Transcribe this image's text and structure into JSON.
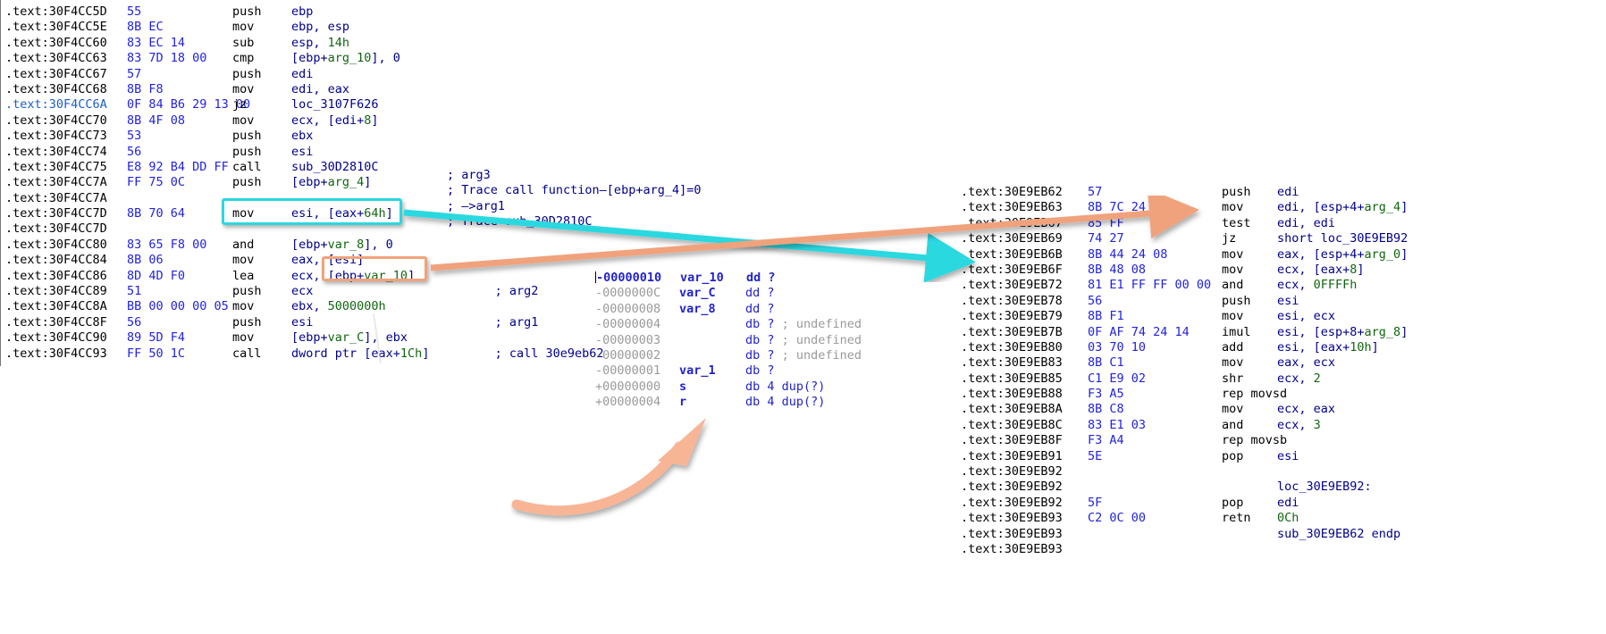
{
  "colors": {
    "highlight_cyan": "#29d8e0",
    "highlight_orange": "#f0a27b",
    "address_text": "#000000",
    "opcode_bytes": "#2222dd",
    "operand": "#00008b",
    "immediate": "#116611",
    "stack_offset_gray": "#9a9a9a",
    "background": "#ffffff"
  },
  "left_listing": {
    "name": "left-disassembly-listing",
    "rows": [
      {
        "addr": ".text:30F4CC5D",
        "bytes": "55",
        "mnem": "push",
        "op": "ebp",
        "op_pre": "",
        "num": "",
        "op_post": "",
        "cmt": ""
      },
      {
        "addr": ".text:30F4CC5E",
        "bytes": "8B EC",
        "mnem": "mov",
        "op": "ebp, esp",
        "cmt": ""
      },
      {
        "addr": ".text:30F4CC60",
        "bytes": "83 EC 14",
        "mnem": "sub",
        "op_pre": "esp, ",
        "num": "14h",
        "op_post": "",
        "cmt": ""
      },
      {
        "addr": ".text:30F4CC63",
        "bytes": "83 7D 18 00",
        "mnem": "cmp",
        "op_pre": "[ebp+",
        "num": "arg_10",
        "op_post": "], 0",
        "cmt": ""
      },
      {
        "addr": ".text:30F4CC67",
        "bytes": "57",
        "mnem": "push",
        "op": "edi",
        "cmt": ""
      },
      {
        "addr": ".text:30F4CC68",
        "bytes": "8B F8",
        "mnem": "mov",
        "op": "edi, eax",
        "cmt": ""
      },
      {
        "addr": ".text:30F4CC6A",
        "bytes": "0F 84 B6 29 13 00",
        "mnem": "jz",
        "op": "loc_3107F626",
        "cmt": "",
        "addr_highlight": true
      },
      {
        "addr": ".text:30F4CC70",
        "bytes": "8B 4F 08",
        "mnem": "mov",
        "op_pre": "ecx, [edi+",
        "num": "8",
        "op_post": "]",
        "cmt": ""
      },
      {
        "addr": ".text:30F4CC73",
        "bytes": "53",
        "mnem": "push",
        "op": "ebx",
        "cmt": ""
      },
      {
        "addr": ".text:30F4CC74",
        "bytes": "56",
        "mnem": "push",
        "op": "esi",
        "cmt": ""
      },
      {
        "addr": ".text:30F4CC75",
        "bytes": "E8 92 B4 DD FF",
        "mnem": "call",
        "op": "sub_30D2810C",
        "cmt": ""
      },
      {
        "addr": ".text:30F4CC7A",
        "bytes": "FF 75 0C",
        "mnem": "push",
        "op_pre": "[ebp+",
        "num": "arg_4",
        "op_post": "]",
        "cmt": ""
      },
      {
        "addr": ".text:30F4CC7A",
        "bytes": "",
        "mnem": "",
        "op": "",
        "cmt": ""
      },
      {
        "addr": ".text:30F4CC7D",
        "bytes": "8B 70 64",
        "mnem": "mov",
        "op_pre": "esi, [eax+",
        "num": "64h",
        "op_post": "]",
        "cmt": ""
      },
      {
        "addr": ".text:30F4CC7D",
        "bytes": "",
        "mnem": "",
        "op": "",
        "cmt": ""
      },
      {
        "addr": ".text:30F4CC80",
        "bytes": "83 65 F8 00",
        "mnem": "and",
        "op_pre": "[ebp+",
        "num": "var_8",
        "op_post": "], 0",
        "cmt": ""
      },
      {
        "addr": ".text:30F4CC84",
        "bytes": "8B 06",
        "mnem": "mov",
        "op": "eax, [esi]",
        "cmt": ""
      },
      {
        "addr": ".text:30F4CC86",
        "bytes": "8D 4D F0",
        "mnem": "lea",
        "op_pre": "ecx, [ebp+",
        "num": "var_10",
        "op_post": "]",
        "cmt": ""
      },
      {
        "addr": ".text:30F4CC89",
        "bytes": "51",
        "mnem": "push",
        "op": "ecx",
        "cmt": "; arg2"
      },
      {
        "addr": ".text:30F4CC8A",
        "bytes": "BB 00 00 00 05",
        "mnem": "mov",
        "op_pre": "ebx, ",
        "num": "5000000h",
        "op_post": "",
        "cmt": ""
      },
      {
        "addr": ".text:30F4CC8F",
        "bytes": "56",
        "mnem": "push",
        "op": "esi",
        "cmt": "; arg1"
      },
      {
        "addr": ".text:30F4CC90",
        "bytes": "89 5D F4",
        "mnem": "mov",
        "op_pre": "[ebp+",
        "num": "var_C",
        "op_post": "], ebx",
        "cmt": ""
      },
      {
        "addr": ".text:30F4CC93",
        "bytes": "FF 50 1C",
        "mnem": "call",
        "op_pre": "dword ptr [eax+",
        "num": "1Ch",
        "op_post": "]",
        "cmt": "; call 30e9eb62"
      }
    ]
  },
  "comment_block": {
    "name": "trace-comment-block",
    "lines": [
      "; arg3",
      "; Trace call function—[ebp+arg_4]=0",
      "; —>arg1",
      "; Trace sub_30D2810C"
    ]
  },
  "stack_frame": {
    "name": "stack-frame-variables",
    "rows": [
      {
        "off": "-00000010",
        "nm": "var_10",
        "rest": "dd ?",
        "cmt": "",
        "selected": true
      },
      {
        "off": "-0000000C",
        "nm": "var_C",
        "rest": "dd ?",
        "cmt": "",
        "selected": false
      },
      {
        "off": "-00000008",
        "nm": "var_8",
        "rest": "dd ?",
        "cmt": "",
        "selected": false
      },
      {
        "off": "-00000004",
        "nm": "",
        "rest": "db ?",
        "cmt": "; undefined",
        "selected": false
      },
      {
        "off": "-00000003",
        "nm": "",
        "rest": "db ?",
        "cmt": "; undefined",
        "selected": false
      },
      {
        "off": "-00000002",
        "nm": "",
        "rest": "db ?",
        "cmt": "; undefined",
        "selected": false
      },
      {
        "off": "-00000001",
        "nm": "var_1",
        "rest": "db ?",
        "cmt": "",
        "selected": false
      },
      {
        "off": "+00000000",
        "nm": "s",
        "rest": "db 4 dup(?)",
        "cmt": "",
        "selected": false
      },
      {
        "off": "+00000004",
        "nm": "r",
        "rest": "db 4 dup(?)",
        "cmt": "",
        "selected": false
      }
    ]
  },
  "right_listing": {
    "name": "right-disassembly-listing",
    "rows": [
      {
        "addr": ".text:30E9EB62",
        "bytes": "57",
        "mnem": "push",
        "op_pre": "edi",
        "num": "",
        "op_post": ""
      },
      {
        "addr": ".text:30E9EB63",
        "bytes": "8B 7C 24 0C",
        "mnem": "mov",
        "op_pre": "edi, [esp+4+",
        "num": "arg_4",
        "op_post": "]"
      },
      {
        "addr": ".text:30E9EB67",
        "bytes": "85 FF",
        "mnem": "test",
        "op_pre": "edi, edi",
        "num": "",
        "op_post": ""
      },
      {
        "addr": ".text:30E9EB69",
        "bytes": "74 27",
        "mnem": "jz",
        "op_pre": "short loc_30E9EB92",
        "num": "",
        "op_post": ""
      },
      {
        "addr": ".text:30E9EB6B",
        "bytes": "8B 44 24 08",
        "mnem": "mov",
        "op_pre": "eax, [esp+4+",
        "num": "arg_0",
        "op_post": "]"
      },
      {
        "addr": ".text:30E9EB6F",
        "bytes": "8B 48 08",
        "mnem": "mov",
        "op_pre": "ecx, [eax+",
        "num": "8",
        "op_post": "]"
      },
      {
        "addr": ".text:30E9EB72",
        "bytes": "81 E1 FF FF 00 00",
        "mnem": "and",
        "op_pre": "ecx, ",
        "num": "0FFFFh",
        "op_post": ""
      },
      {
        "addr": ".text:30E9EB78",
        "bytes": "56",
        "mnem": "push",
        "op_pre": "esi",
        "num": "",
        "op_post": ""
      },
      {
        "addr": ".text:30E9EB79",
        "bytes": "8B F1",
        "mnem": "mov",
        "op_pre": "esi, ecx",
        "num": "",
        "op_post": ""
      },
      {
        "addr": ".text:30E9EB7B",
        "bytes": "0F AF 74 24 14",
        "mnem": "imul",
        "op_pre": "esi, [esp+8+",
        "num": "arg_8",
        "op_post": "]"
      },
      {
        "addr": ".text:30E9EB80",
        "bytes": "03 70 10",
        "mnem": "add",
        "op_pre": "esi, [eax+",
        "num": "10h",
        "op_post": "]"
      },
      {
        "addr": ".text:30E9EB83",
        "bytes": "8B C1",
        "mnem": "mov",
        "op_pre": "eax, ecx",
        "num": "",
        "op_post": ""
      },
      {
        "addr": ".text:30E9EB85",
        "bytes": "C1 E9 02",
        "mnem": "shr",
        "op_pre": "ecx, ",
        "num": "2",
        "op_post": ""
      },
      {
        "addr": ".text:30E9EB88",
        "bytes": "F3 A5",
        "mnem": "rep movsd",
        "op_pre": "",
        "num": "",
        "op_post": ""
      },
      {
        "addr": ".text:30E9EB8A",
        "bytes": "8B C8",
        "mnem": "mov",
        "op_pre": "ecx, eax",
        "num": "",
        "op_post": ""
      },
      {
        "addr": ".text:30E9EB8C",
        "bytes": "83 E1 03",
        "mnem": "and",
        "op_pre": "ecx, ",
        "num": "3",
        "op_post": ""
      },
      {
        "addr": ".text:30E9EB8F",
        "bytes": "F3 A4",
        "mnem": "rep movsb",
        "op_pre": "",
        "num": "",
        "op_post": ""
      },
      {
        "addr": ".text:30E9EB91",
        "bytes": "5E",
        "mnem": "pop",
        "op_pre": "esi",
        "num": "",
        "op_post": ""
      },
      {
        "addr": ".text:30E9EB92",
        "bytes": "",
        "mnem": "",
        "op_pre": "",
        "num": "",
        "op_post": ""
      },
      {
        "addr": ".text:30E9EB92",
        "bytes": "",
        "mnem": "",
        "op_pre": "loc_30E9EB92:",
        "num": "",
        "op_post": ""
      },
      {
        "addr": ".text:30E9EB92",
        "bytes": "5F",
        "mnem": "pop",
        "op_pre": "edi",
        "num": "",
        "op_post": ""
      },
      {
        "addr": ".text:30E9EB93",
        "bytes": "C2 0C 00",
        "mnem": "retn",
        "op_pre": "",
        "num": "0Ch",
        "op_post": ""
      },
      {
        "addr": ".text:30E9EB93",
        "bytes": "",
        "mnem": "",
        "op_pre": "sub_30E9EB62 endp",
        "num": "",
        "op_post": ""
      },
      {
        "addr": ".text:30E9EB93",
        "bytes": "",
        "mnem": "",
        "op_pre": "",
        "num": "",
        "op_post": ""
      }
    ]
  },
  "annotations": {
    "cyan_box_target": "mov esi, [eax+64h]",
    "orange_box_target": "[ebp+var_10]",
    "cyan_arrow_label": "links mov esi,[eax+64h] to .text:30E9EB6B",
    "orange_arrow_top_label": "links [ebp+var_10] to .text:30E9EB63",
    "orange_arrow_curve_label": "links stack frame var_10 up to lea ecx,[ebp+var_10]"
  }
}
